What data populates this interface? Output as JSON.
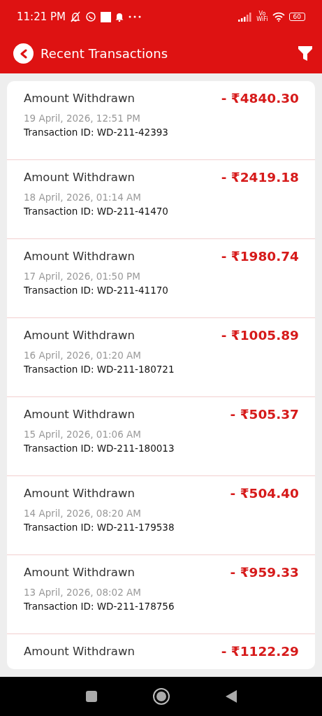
{
  "status_bar": {
    "time": "11:21 PM",
    "network_label_top": "Vo",
    "network_label_bottom": "WiFi",
    "battery": "60"
  },
  "header": {
    "title": "Recent Transactions"
  },
  "transactions": [
    {
      "title": "Amount Withdrawn",
      "amount": "- ₹4840.30",
      "date": "19 April, 2026, 12:51 PM",
      "transaction_id": "Transaction ID: WD-211-42393"
    },
    {
      "title": "Amount Withdrawn",
      "amount": "- ₹2419.18",
      "date": "18 April, 2026, 01:14 AM",
      "transaction_id": "Transaction ID: WD-211-41470"
    },
    {
      "title": "Amount Withdrawn",
      "amount": "- ₹1980.74",
      "date": "17 April, 2026, 01:50 PM",
      "transaction_id": "Transaction ID: WD-211-41170"
    },
    {
      "title": "Amount Withdrawn",
      "amount": "- ₹1005.89",
      "date": "16 April, 2026, 01:20 AM",
      "transaction_id": "Transaction ID: WD-211-180721"
    },
    {
      "title": "Amount Withdrawn",
      "amount": "- ₹505.37",
      "date": "15 April, 2026, 01:06 AM",
      "transaction_id": "Transaction ID: WD-211-180013"
    },
    {
      "title": "Amount Withdrawn",
      "amount": "- ₹504.40",
      "date": "14 April, 2026, 08:20 AM",
      "transaction_id": "Transaction ID: WD-211-179538"
    },
    {
      "title": "Amount Withdrawn",
      "amount": "- ₹959.33",
      "date": "13 April, 2026, 08:02 AM",
      "transaction_id": "Transaction ID: WD-211-178756"
    },
    {
      "title": "Amount Withdrawn",
      "amount": "- ₹1122.29"
    }
  ]
}
